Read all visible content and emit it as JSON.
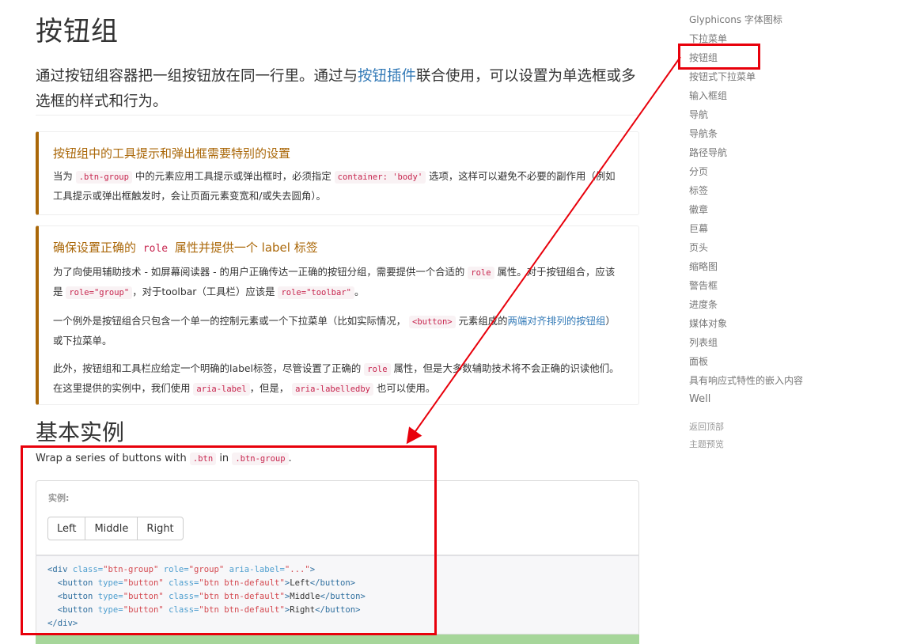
{
  "page": {
    "title": "按钮组",
    "lead": {
      "before": "通过按钮组容器把一组按钮放在同一行里。通过与",
      "link": "按钮插件",
      "after": "联合使用，可以设置为单选框或多选框的样式和行为。"
    }
  },
  "callout1": {
    "heading": "按钮组中的工具提示和弹出框需要特别的设置",
    "p1": "当为",
    "code1": ".btn-group",
    "p2": "中的元素应用工具提示或弹出框时，必须指定",
    "code2": "container: 'body'",
    "p3": "选项，这样可以避免不必要的副作用（例如工具提示或弹出框触发时，会让页面元素变宽和/或失去圆角）。"
  },
  "callout2": {
    "heading_before": "确保设置正确的",
    "heading_code": "role",
    "heading_after": "属性并提供一个 label 标签",
    "para1_a": "为了向使用辅助技术 - 如屏幕阅读器 - 的用户正确传达一正确的按钮分组，需要提供一个合适的",
    "para1_code1": "role",
    "para1_b": "属性。对于按钮组合，应该是",
    "para1_code2": "role=\"group\"",
    "para1_c": "，对于toolbar（工具栏）应该是",
    "para1_code3": "role=\"toolbar\"",
    "para1_d": "。",
    "para2_a": "一个例外是按钮组合只包含一个单一的控制元素或一个下拉菜单（比如实际情况，",
    "para2_code": "<button>",
    "para2_b": "元素组成的",
    "para2_link": "两端对齐排列的按钮组",
    "para2_c": "）或下拉菜单。",
    "para3_a": "此外，按钮组和工具栏应给定一个明确的label标签，尽管设置了正确的",
    "para3_code1": "role",
    "para3_b": "属性，但是大多数辅助技术将不会正确的识读他们。在这里提供的实例中，我们使用",
    "para3_code2": "aria-label",
    "para3_c": "，但是，",
    "para3_code3": "aria-labelledby",
    "para3_d": "也可以使用。"
  },
  "section": {
    "title": "基本实例",
    "intro_before": "Wrap a series of buttons with",
    "intro_code1": ".btn",
    "intro_mid": "in",
    "intro_code2": ".btn-group",
    "intro_after": "."
  },
  "example": {
    "label": "实例:",
    "buttons": [
      "Left",
      "Middle",
      "Right"
    ]
  },
  "code_lines": {
    "l1_t1": "<div",
    "l1_a1": " class=",
    "l1_v1": "\"btn-group\"",
    "l1_a2": " role=",
    "l1_v2": "\"group\"",
    "l1_a3": " aria-label=",
    "l1_v3": "\"...\"",
    "l1_t2": ">",
    "btn_open": "<button",
    "btn_type_attr": " type=",
    "btn_type_val": "\"button\"",
    "btn_class_attr": " class=",
    "btn_class_val": "\"btn btn-default\"",
    "btn_close_start": ">",
    "btn_end": "</button>",
    "left": "Left",
    "middle": "Middle",
    "right": "Right",
    "div_end": "</div>"
  },
  "sidenav": {
    "items": [
      "Glyphicons 字体图标",
      "下拉菜单",
      "按钮组",
      "按钮式下拉菜单",
      "输入框组",
      "导航",
      "导航条",
      "路径导航",
      "分页",
      "标签",
      "徽章",
      "巨幕",
      "页头",
      "缩略图",
      "警告框",
      "进度条",
      "媒体对象",
      "列表组",
      "面板",
      "具有响应式特性的嵌入内容",
      "Well"
    ],
    "footer": [
      "返回顶部",
      "主题预览"
    ]
  },
  "colors": {
    "annotation": "#e8000b",
    "callout_border": "#aa6708",
    "link": "#337ab7",
    "code": "#c7254e"
  }
}
